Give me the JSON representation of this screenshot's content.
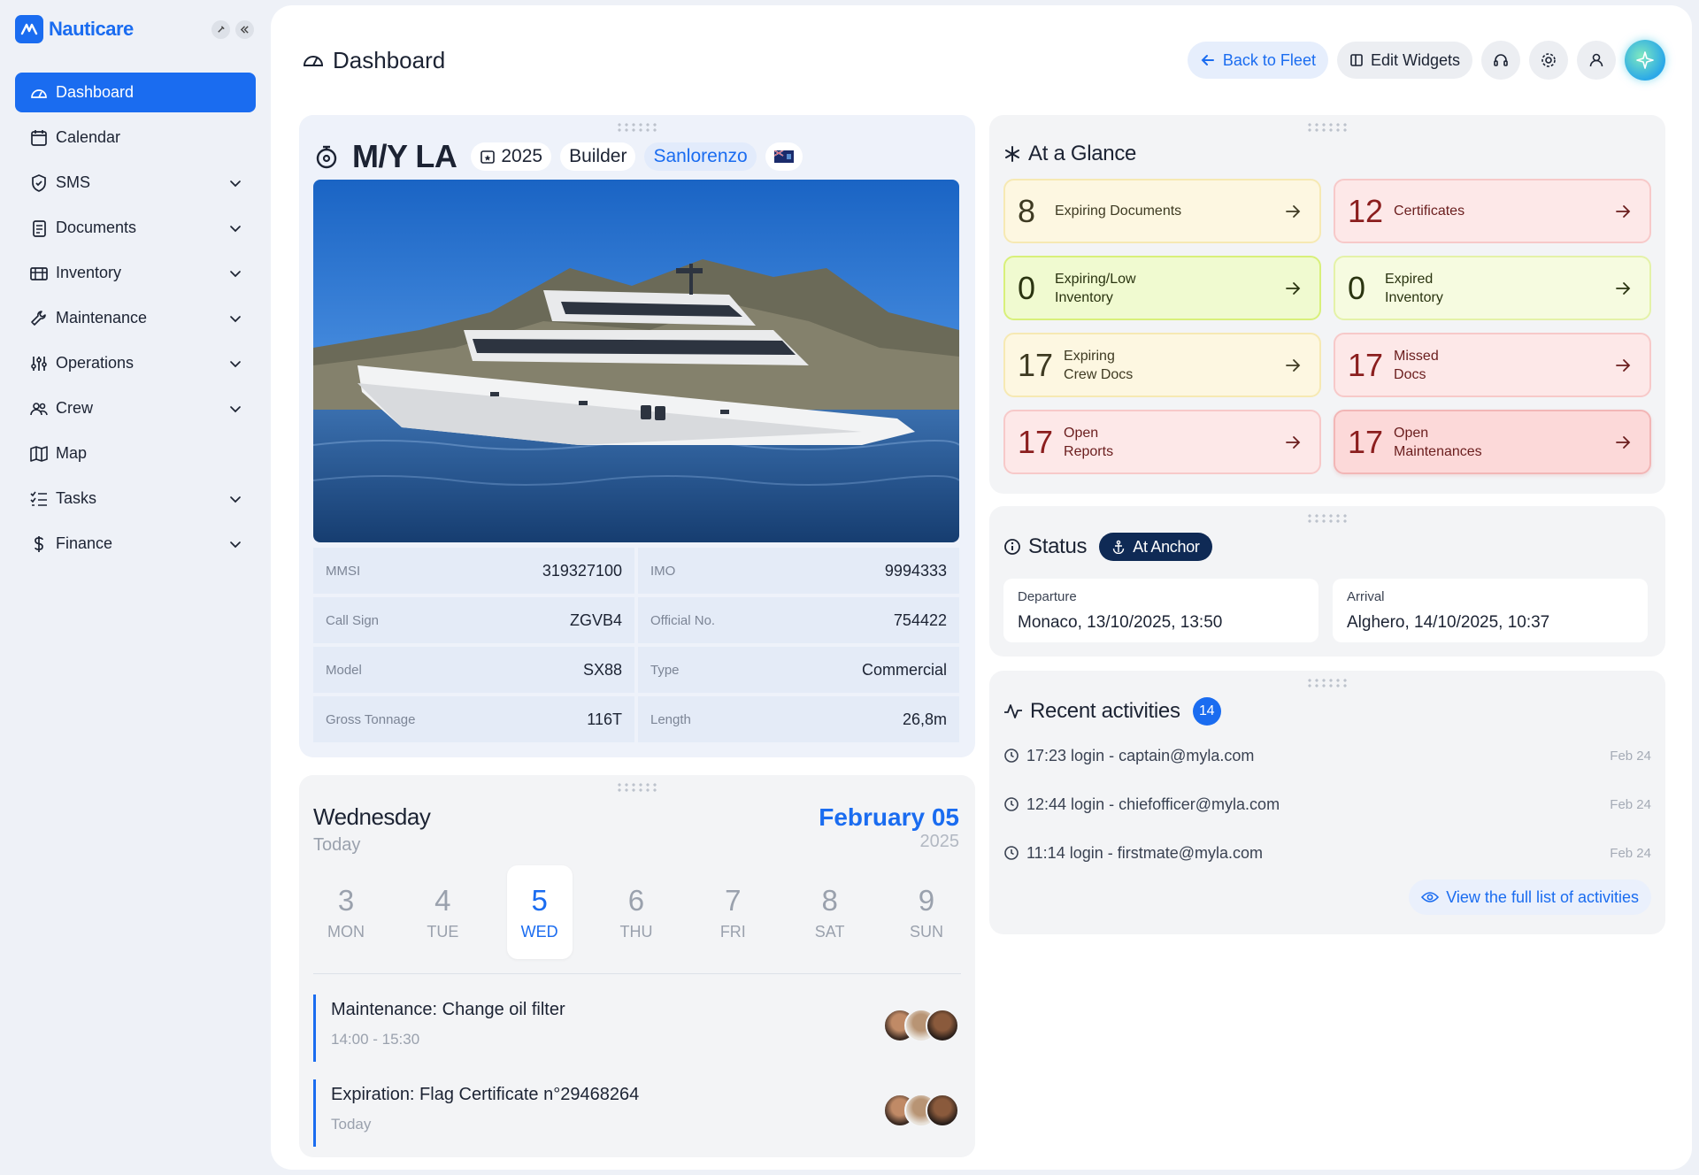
{
  "brand": {
    "name": "Nauticare"
  },
  "nav": [
    {
      "label": "Dashboard",
      "icon": "dashboard-icon",
      "active": true,
      "chevron": false
    },
    {
      "label": "Calendar",
      "icon": "calendar-icon",
      "active": false,
      "chevron": false
    },
    {
      "label": "SMS",
      "icon": "shield-icon",
      "active": false,
      "chevron": true
    },
    {
      "label": "Documents",
      "icon": "documents-icon",
      "active": false,
      "chevron": true
    },
    {
      "label": "Inventory",
      "icon": "inventory-icon",
      "active": false,
      "chevron": true
    },
    {
      "label": "Maintenance",
      "icon": "wrench-icon",
      "active": false,
      "chevron": true
    },
    {
      "label": "Operations",
      "icon": "sliders-icon",
      "active": false,
      "chevron": true
    },
    {
      "label": "Crew",
      "icon": "crew-icon",
      "active": false,
      "chevron": true
    },
    {
      "label": "Map",
      "icon": "map-icon",
      "active": false,
      "chevron": false
    },
    {
      "label": "Tasks",
      "icon": "tasks-icon",
      "active": false,
      "chevron": true
    },
    {
      "label": "Finance",
      "icon": "dollar-icon",
      "active": false,
      "chevron": true
    }
  ],
  "header": {
    "title": "Dashboard",
    "back_label": "Back to Fleet",
    "edit_label": "Edit Widgets"
  },
  "vessel": {
    "name": "M/Y LA",
    "year": "2025",
    "builder_label": "Builder",
    "builder": "Sanlorenzo",
    "specs": [
      {
        "label": "MMSI",
        "value": "319327100"
      },
      {
        "label": "IMO",
        "value": "9994333"
      },
      {
        "label": "Call Sign",
        "value": "ZGVB4"
      },
      {
        "label": "Official No.",
        "value": "754422"
      },
      {
        "label": "Model",
        "value": "SX88"
      },
      {
        "label": "Type",
        "value": "Commercial"
      },
      {
        "label": "Gross Tonnage",
        "value": "116T"
      },
      {
        "label": "Length",
        "value": "26,8m"
      }
    ]
  },
  "calendar": {
    "weekday": "Wednesday",
    "today_label": "Today",
    "date": "February 05",
    "year": "2025",
    "week": [
      {
        "num": "3",
        "label": "MON",
        "active": false
      },
      {
        "num": "4",
        "label": "TUE",
        "active": false
      },
      {
        "num": "5",
        "label": "WED",
        "active": true
      },
      {
        "num": "6",
        "label": "THU",
        "active": false
      },
      {
        "num": "7",
        "label": "FRI",
        "active": false
      },
      {
        "num": "8",
        "label": "SAT",
        "active": false
      },
      {
        "num": "9",
        "label": "SUN",
        "active": false
      }
    ],
    "events": [
      {
        "title": "Maintenance: Change oil filter",
        "time": "14:00 - 15:30"
      },
      {
        "title": "Expiration: Flag Certificate n°29468264",
        "time": "Today"
      }
    ]
  },
  "glance": {
    "title": "At a Glance",
    "tiles": [
      {
        "num": "8",
        "line1": "Expiring Documents",
        "line2": "",
        "style": "yellow"
      },
      {
        "num": "12",
        "line1": "Certificates",
        "line2": "",
        "style": "red"
      },
      {
        "num": "0",
        "line1": "Expiring/Low",
        "line2": "Inventory",
        "style": "green"
      },
      {
        "num": "0",
        "line1": "Expired",
        "line2": "Inventory",
        "style": "lime"
      },
      {
        "num": "17",
        "line1": "Expiring",
        "line2": "Crew Docs",
        "style": "yellow"
      },
      {
        "num": "17",
        "line1": "Missed",
        "line2": "Docs",
        "style": "red"
      },
      {
        "num": "17",
        "line1": "Open",
        "line2": "Reports",
        "style": "red"
      },
      {
        "num": "17",
        "line1": "Open",
        "line2": "Maintenances",
        "style": "red2"
      }
    ]
  },
  "status": {
    "title": "Status",
    "badge": "At Anchor",
    "departure_label": "Departure",
    "departure": "Monaco, 13/10/2025, 13:50",
    "arrival_label": "Arrival",
    "arrival": "Alghero, 14/10/2025, 10:37"
  },
  "activities": {
    "title": "Recent activities",
    "count": "14",
    "items": [
      {
        "text": "17:23 login - captain@myla.com",
        "date": "Feb 24"
      },
      {
        "text": "12:44 login - chiefofficer@myla.com",
        "date": "Feb 24"
      },
      {
        "text": "11:14 login - firstmate@myla.com",
        "date": "Feb 24"
      }
    ],
    "view_all": "View the full list of activities"
  },
  "colors": {
    "accent": "#1a6cf0",
    "navy": "#0f2a55"
  }
}
